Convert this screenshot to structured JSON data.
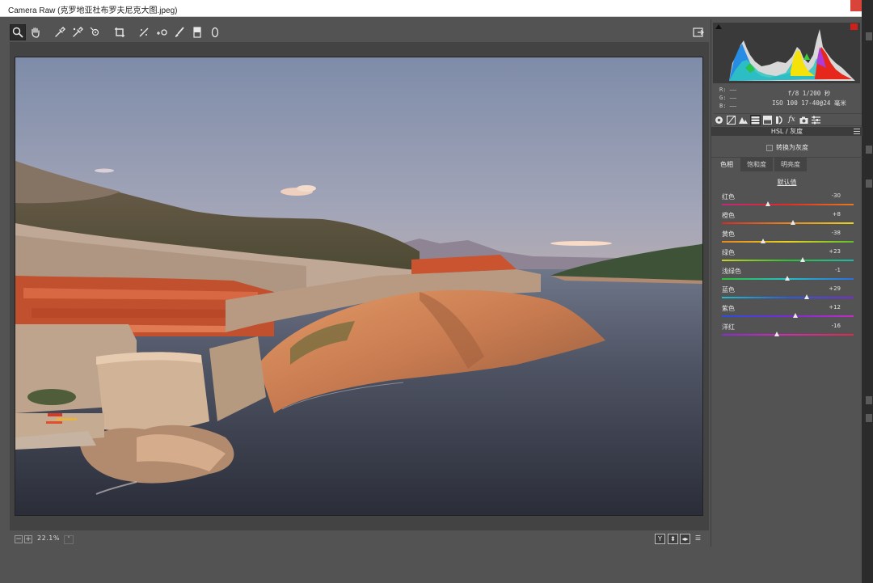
{
  "window": {
    "title": "Camera Raw (克罗地亚杜布罗夫尼克大图.jpeg)"
  },
  "toolbar": {
    "tools": [
      {
        "name": "zoom-tool",
        "icon": "magnifier-icon",
        "active": true
      },
      {
        "name": "hand-tool",
        "icon": "hand-icon"
      },
      {
        "name": "white-balance-tool",
        "icon": "eyedropper-icon"
      },
      {
        "name": "color-sampler-tool",
        "icon": "color-sampler-icon"
      },
      {
        "name": "targeted-adjustment-tool",
        "icon": "target-adjust-icon"
      },
      {
        "name": "crop-tool",
        "icon": "crop-icon"
      },
      {
        "name": "straighten-tool",
        "icon": "straighten-icon"
      },
      {
        "name": "spot-removal-tool",
        "icon": "spot-removal-icon"
      },
      {
        "name": "red-eye-tool",
        "icon": "red-eye-icon"
      },
      {
        "name": "adjustment-brush-tool",
        "icon": "brush-icon"
      },
      {
        "name": "graduated-filter-tool",
        "icon": "gradient-icon"
      },
      {
        "name": "radial-filter-tool",
        "icon": "ellipse-icon"
      }
    ]
  },
  "bottombar": {
    "zoom_out": "−",
    "zoom_in": "+",
    "zoom": "22.1%",
    "zoom_dropdown": "˅",
    "view_buttons": [
      "Y",
      "⬍",
      "◂▸",
      "☰"
    ]
  },
  "histogram": {
    "shadow_clip_color": "#111111",
    "highlight_clip_color": "#d0201a"
  },
  "readout": {
    "r": "R:  ——",
    "g": "G:  ——",
    "b": "B:  ——",
    "exposure": "f/8   1/200 秒",
    "iso": "ISO 100   17-40@24 毫米"
  },
  "panel": {
    "tabs": [
      {
        "name": "basic",
        "icon": "aperture-icon"
      },
      {
        "name": "tone-curve",
        "icon": "curve-icon"
      },
      {
        "name": "detail",
        "icon": "mountain-icon"
      },
      {
        "name": "hsl",
        "icon": "hsl-icon",
        "active": true
      },
      {
        "name": "split-toning",
        "icon": "split-tone-icon"
      },
      {
        "name": "lens",
        "icon": "lens-icon"
      },
      {
        "name": "effects",
        "icon": "fx-icon",
        "text": "fx"
      },
      {
        "name": "camera-calibration",
        "icon": "camera-icon"
      },
      {
        "name": "presets",
        "icon": "sliders-icon"
      }
    ],
    "section_title": "HSL / 灰度",
    "convert_gray": "转换为灰度",
    "convert_gray_checked": false,
    "subtabs": [
      "色相",
      "饱和度",
      "明亮度"
    ],
    "active_subtab": 0,
    "defaults": "默认值",
    "sliders": [
      {
        "label": "红色",
        "value": "-30",
        "num": -30
      },
      {
        "label": "橙色",
        "value": "+8",
        "num": 8
      },
      {
        "label": "黄色",
        "value": "-38",
        "num": -38
      },
      {
        "label": "绿色",
        "value": "+23",
        "num": 23
      },
      {
        "label": "浅绿色",
        "value": "-1",
        "num": -1
      },
      {
        "label": "蓝色",
        "value": "+29",
        "num": 29
      },
      {
        "label": "紫色",
        "value": "+12",
        "num": 12
      },
      {
        "label": "洋红",
        "value": "-16",
        "num": -16
      }
    ]
  }
}
